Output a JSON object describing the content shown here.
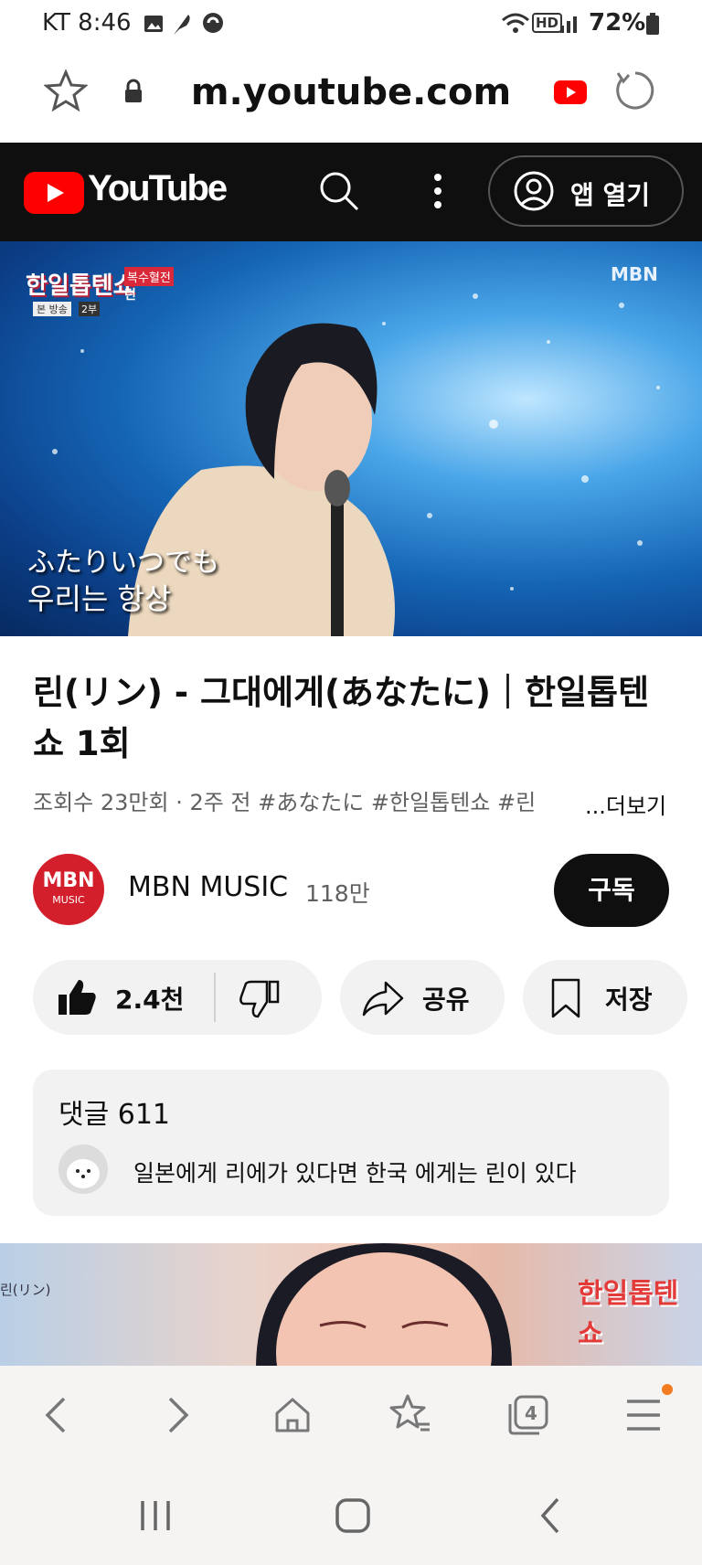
{
  "status_bar": {
    "carrier_time": "KT 8:46",
    "network": "HD",
    "battery": "72%"
  },
  "browser": {
    "url": "m.youtube.com"
  },
  "yt_header": {
    "logo_text": "YouTube",
    "open_app_label": "앱 열기"
  },
  "video": {
    "channel_logo": "MBN",
    "show_logo": "한일톱텐쇼",
    "show_badge": "복수혈전",
    "show_badge_name": "린",
    "broadcast_label": "본 방송",
    "broadcast_part": "2부",
    "subtitle_jp": "ふたりいつでも",
    "subtitle_kr": "우리는 항상"
  },
  "title": "린(リン) - 그대에게(あなたに)｜한일톱텐쇼 1회",
  "meta": "조회수 23만회 · 2주 전  #あなたに #한일톱텐쇼 #린",
  "more_label": "...더보기",
  "channel": {
    "avatar_text": "MBN",
    "avatar_sub": "MUSIC",
    "name": "MBN MUSIC",
    "subs": "118만",
    "subscribe_label": "구독"
  },
  "actions": {
    "like_count": "2.4천",
    "share_label": "공유",
    "save_label": "저장"
  },
  "comments": {
    "title": "댓글 611",
    "top_comment": "일본에게 리에가 있다면 한국 에게는 린이 있다"
  },
  "next_video": {
    "left_label": "린(リン)",
    "right_logo": "한일톱텐쇼"
  },
  "browser_nav": {
    "tabs_count": "4"
  },
  "colors": {
    "yt_red": "#ff0000",
    "header_bg": "#0f0f0f",
    "mbn_red": "#d31f2b",
    "notify_dot": "#f37b22"
  }
}
